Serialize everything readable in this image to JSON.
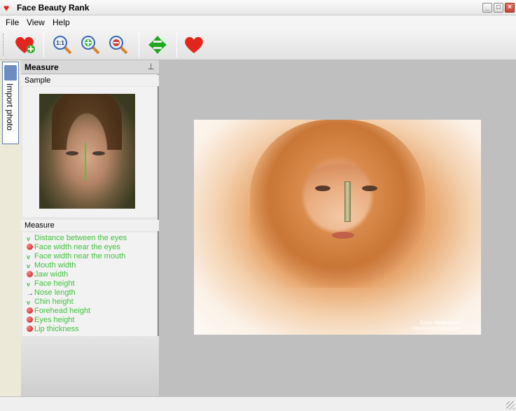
{
  "window": {
    "title": "Face Beauty Rank",
    "app_icon": "heart-icon",
    "controls": [
      "minimize",
      "maximize",
      "close"
    ]
  },
  "menu": [
    {
      "label": "File"
    },
    {
      "label": "View"
    },
    {
      "label": "Help"
    }
  ],
  "toolbar": [
    {
      "name": "add-photo",
      "icon": "heart-plus-icon"
    },
    {
      "name": "zoom-actual",
      "icon": "zoom-1to1-icon"
    },
    {
      "name": "zoom-in",
      "icon": "zoom-in-icon"
    },
    {
      "name": "zoom-out",
      "icon": "zoom-out-icon"
    },
    {
      "name": "move",
      "icon": "move-arrows-icon"
    },
    {
      "name": "rank",
      "icon": "heart-icon"
    }
  ],
  "side_tab": {
    "label": "Import photo",
    "icon": "person-icon"
  },
  "panel": {
    "title": "Measure",
    "pin_icon": "pin-icon",
    "sample_label": "Sample",
    "measure_label": "Measure",
    "items": [
      {
        "label": "Distance between the eyes",
        "status": "check"
      },
      {
        "label": "Face width near the eyes",
        "status": "dot"
      },
      {
        "label": "Face width near the mouth",
        "status": "check"
      },
      {
        "label": "Mouth width",
        "status": "check"
      },
      {
        "label": "Jaw width",
        "status": "dot"
      },
      {
        "label": "Face height",
        "status": "check"
      },
      {
        "label": "Nose length",
        "status": "arrow"
      },
      {
        "label": "Chin height",
        "status": "check"
      },
      {
        "label": "Forehead height",
        "status": "dot"
      },
      {
        "label": "Eyes height",
        "status": "dot"
      },
      {
        "label": "Lip thickness",
        "status": "dot"
      }
    ]
  },
  "photo": {
    "watermark_line1": "Super Wallpapers!",
    "watermark_line2": "http://www.supwal.net"
  },
  "colors": {
    "measured": "#3fc23f",
    "pending": "#d01818",
    "active": "#3b4fc8",
    "workspace": "#bfbfbf"
  }
}
